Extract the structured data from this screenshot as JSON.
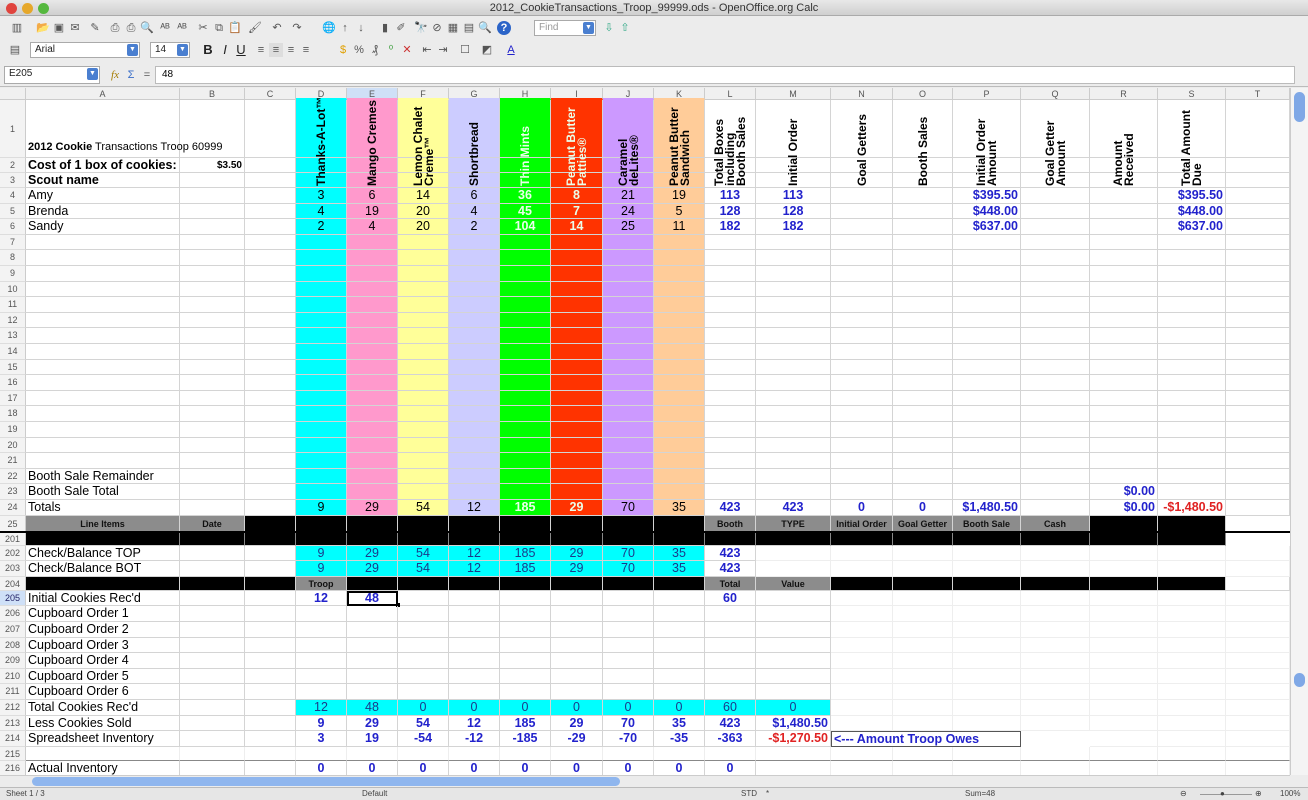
{
  "window": {
    "title": "2012_CookieTransactions_Troop_99999.ods - OpenOffice.org Calc"
  },
  "toolbar": {
    "find_placeholder": "Find",
    "font_name": "Arial",
    "font_size": "14",
    "bold": "B",
    "italic": "I",
    "underline": "U",
    "icons": [
      "new-icon",
      "open-icon",
      "save-icon",
      "email-icon",
      "edit-icon",
      "pdf-icon",
      "print-icon",
      "print-preview-icon",
      "spellcheck-icon",
      "autospell-icon",
      "cut-icon",
      "copy-icon",
      "paste-icon",
      "format-paintbrush-icon",
      "undo-icon",
      "redo-icon",
      "hyperlink-icon",
      "sort-ascending-icon",
      "sort-descending-icon",
      "chart-icon",
      "draw-icon",
      "find-replace-icon",
      "navigator-icon",
      "gallery-icon",
      "datasource-icon",
      "zoom-icon",
      "help-icon"
    ]
  },
  "formula_bar": {
    "cell_ref": "E205",
    "fx": "fx",
    "sum": "Σ",
    "eq": "=",
    "value": "48"
  },
  "columns": [
    "A",
    "B",
    "C",
    "D",
    "E",
    "F",
    "G",
    "H",
    "I",
    "J",
    "K",
    "L",
    "M",
    "N",
    "O",
    "P",
    "Q",
    "R",
    "S",
    "T"
  ],
  "colors": {
    "thanks": "#00ffff",
    "mango": "#ff99cc",
    "lemon": "#ffff99",
    "shortbread": "#ccccff",
    "thin": "#00ff00",
    "pbp": "#ff3300",
    "caramel": "#cc99ff",
    "pbs": "#ffcc99",
    "blue_text": "#2222cc",
    "red_text": "#e02222"
  },
  "sheet": {
    "title_bold": "2012 Cookie",
    "title_rest": " Transactions Troop 60999",
    "cost_label": "Cost of 1 box of cookies:",
    "cost_value": "$3.50",
    "scout_label": "Scout name",
    "headers": {
      "D": "Thanks-A-Lot™",
      "E": "Mango Cremes",
      "F": "Lemon Chalet\nCreme™",
      "G": "Shortbread",
      "H": "Thin Mints",
      "I": "Peanut Butter\nPatties®",
      "J": "Caramel\ndeLites®",
      "K": "Peanut Butter\nSandwich",
      "L": "Total Boxes\nincluding\nBooth Sales",
      "M": "Initial Order",
      "N": "Goal Getters",
      "O": "Booth Sales",
      "P": "Initial Order\nAmount",
      "Q": "Goal Getter\nAmount",
      "R": "Amount\nReceived",
      "S": "Total Amount\nDue"
    },
    "scouts": [
      {
        "name": "Amy",
        "D": "3",
        "E": "6",
        "F": "14",
        "G": "6",
        "H": "36",
        "I": "8",
        "J": "21",
        "K": "19",
        "L": "113",
        "M": "113",
        "P": "$395.50",
        "S": "$395.50"
      },
      {
        "name": "Brenda",
        "D": "4",
        "E": "19",
        "F": "20",
        "G": "4",
        "H": "45",
        "I": "7",
        "J": "24",
        "K": "5",
        "L": "128",
        "M": "128",
        "P": "$448.00",
        "S": "$448.00"
      },
      {
        "name": "Sandy",
        "D": "2",
        "E": "4",
        "F": "20",
        "G": "2",
        "H": "104",
        "I": "14",
        "J": "25",
        "K": "11",
        "L": "182",
        "M": "182",
        "P": "$637.00",
        "S": "$637.00"
      }
    ],
    "booth_remainder": "Booth Sale Remainder",
    "booth_total": "Booth Sale Total",
    "booth_total_R": "$0.00",
    "totals": {
      "label": "Totals",
      "D": "9",
      "E": "29",
      "F": "54",
      "G": "12",
      "H": "185",
      "I": "29",
      "J": "70",
      "K": "35",
      "L": "423",
      "M": "423",
      "N": "0",
      "O": "0",
      "P": "$1,480.50",
      "R": "$0.00",
      "S": "-$1,480.50"
    },
    "row25": {
      "A": "Line Items",
      "B": "Date",
      "L": "Booth",
      "M": "TYPE",
      "N": "Initial Order",
      "O": "Goal Getter",
      "P": "Booth Sale",
      "Q": "Cash"
    },
    "check_top": {
      "label": "Check/Balance TOP",
      "vals": [
        "9",
        "29",
        "54",
        "12",
        "185",
        "29",
        "70",
        "35"
      ],
      "L": "423"
    },
    "check_bot": {
      "label": "Check/Balance BOT",
      "vals": [
        "9",
        "29",
        "54",
        "12",
        "185",
        "29",
        "70",
        "35"
      ],
      "L": "423"
    },
    "row204": {
      "D": "Troop",
      "L": "Total",
      "M": "Value"
    },
    "initial": {
      "label": "Initial Cookies Rec'd",
      "D": "12",
      "E": "48",
      "L": "60"
    },
    "cupboard": [
      "Cupboard Order 1",
      "Cupboard Order 2",
      "Cupboard Order 3",
      "Cupboard Order 4",
      "Cupboard Order 5",
      "Cupboard Order 6"
    ],
    "total_recd": {
      "label": "Total Cookies Rec'd",
      "vals": [
        "12",
        "48",
        "0",
        "0",
        "0",
        "0",
        "0",
        "0"
      ],
      "L": "60",
      "M": "0"
    },
    "less_sold": {
      "label": "Less Cookies Sold",
      "vals": [
        "9",
        "29",
        "54",
        "12",
        "185",
        "29",
        "70",
        "35"
      ],
      "L": "423",
      "M": "$1,480.50"
    },
    "sheet_inv": {
      "label": "Spreadsheet Inventory",
      "vals": [
        "3",
        "19",
        "-54",
        "-12",
        "-185",
        "-29",
        "-70",
        "-35"
      ],
      "L": "-363",
      "M": "-$1,270.50",
      "note": "<--- Amount Troop Owes"
    },
    "actual_inv": {
      "label": "Actual Inventory",
      "vals": [
        "0",
        "0",
        "0",
        "0",
        "0",
        "0",
        "0",
        "0"
      ],
      "L": "0"
    }
  },
  "status": {
    "sheet": "Sheet 1 / 3",
    "style": "Default",
    "mode": "STD",
    "modified": "*",
    "sum": "Sum=48",
    "zoom": "100%"
  }
}
